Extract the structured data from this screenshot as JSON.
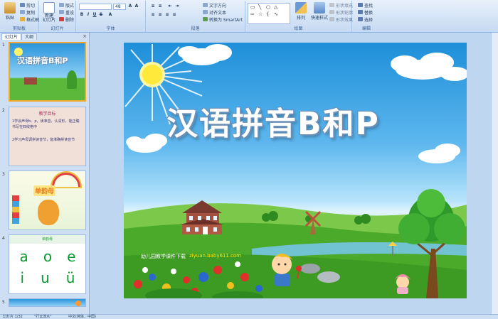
{
  "ribbon": {
    "clipboard": {
      "paste": "粘贴",
      "cut": "剪切",
      "copy": "复制",
      "format_painter": "格式刷",
      "group": "剪贴板"
    },
    "slides": {
      "new_slide": "新建\n幻灯片",
      "layout": "版式",
      "reset": "重设",
      "delete": "删除",
      "group": "幻灯片"
    },
    "font": {
      "font_name": "",
      "font_size": "48",
      "group": "字体"
    },
    "paragraph": {
      "text_direction": "文字方向",
      "align_text": "对齐文本",
      "smartart": "转换为 SmartArt",
      "group": "段落"
    },
    "drawing": {
      "arrange": "排列",
      "quick_styles": "快速样式",
      "shape_fill": "形状填充",
      "shape_outline": "形状轮廓",
      "shape_effects": "形状效果",
      "group": "绘图"
    },
    "editing": {
      "find": "查找",
      "replace": "替换",
      "select": "选择",
      "group": "编辑"
    }
  },
  "pane": {
    "tabs": [
      "幻灯片",
      "大纲"
    ],
    "close": "×",
    "numbers": [
      "1",
      "2",
      "3",
      "4",
      "5"
    ],
    "thumb1_title": "汉语拼音B和P",
    "thumb2_title": "教学目标",
    "thumb2_lines": [
      "1学会声母b、p，读准音，认清形，能正确书写在四线格中",
      "2学习声母调拼读音节，能准确拼读音节"
    ],
    "thumb3_word": "单韵母",
    "thumb4_header": "单韵母",
    "vowels": [
      "a",
      "o",
      "e",
      "i",
      "u",
      "ü"
    ]
  },
  "slide": {
    "title": "汉语拼音B和P",
    "caption_left": "幼儿园教学课件下载",
    "caption_url": "ziyuan.baby611.com"
  },
  "status": {
    "slide_info": "幻灯片 1/32",
    "theme": "\"行云流水\"",
    "language": "中文(简体，中国)"
  },
  "colors": {
    "sky": "#1d8fd9",
    "grass": "#4caa2a",
    "title_outline": "#6a8fb8",
    "url_text": "#ffe600",
    "selection": "#f0a830"
  }
}
